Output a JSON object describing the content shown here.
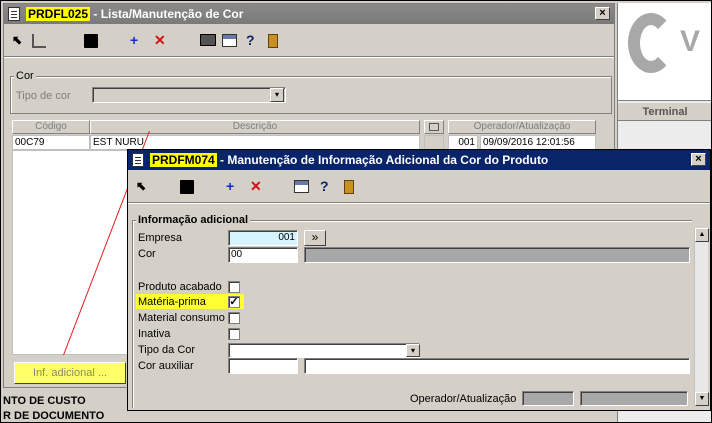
{
  "back_window": {
    "code": "PRDFL025",
    "title_rest": " - Lista/Manutenção de Cor",
    "close": "×",
    "group_label": "Cor",
    "tipo_label": "Tipo de cor",
    "columns": [
      "Código",
      "Descrição",
      "Operador/Atualização"
    ],
    "row": {
      "codigo": "00C79",
      "descricao": "EST NURU",
      "operador": "001",
      "data": "09/09/2016 12:01:56"
    },
    "inf_button": "Inf. adicional ...",
    "bottom_lines": [
      "NTO DE CUSTO",
      "R DE DOCUMENTO"
    ]
  },
  "right_panel": {
    "logo_letter": "V",
    "header": "Terminal"
  },
  "front_window": {
    "code": "PRDFM074",
    "title_rest": " - Manutenção de Informação Adicional da Cor do Produto",
    "close": "×",
    "group_label": "Informação adicional",
    "empresa_label": "Empresa",
    "empresa_value": "001",
    "empresa_btn": "»",
    "cor_label": "Cor",
    "cor_value": "00",
    "produto_acabado": "Produto acabado",
    "materia_prima": "Matéria-prima",
    "materia_prima_check": "✓",
    "material_consumo": "Material consumo",
    "inativa": "Inativa",
    "tipo_cor": "Tipo da Cor",
    "cor_auxiliar": "Cor auxiliar",
    "operador": "Operador/Atualização"
  },
  "icons": {
    "plus": "+",
    "times": "✕",
    "question": "?",
    "dropdown": "▾",
    "up": "▲",
    "down": "▼"
  },
  "colors": {
    "highlight": "#ffff00",
    "active_title": "#0a246a",
    "arrow": "#e02020"
  }
}
